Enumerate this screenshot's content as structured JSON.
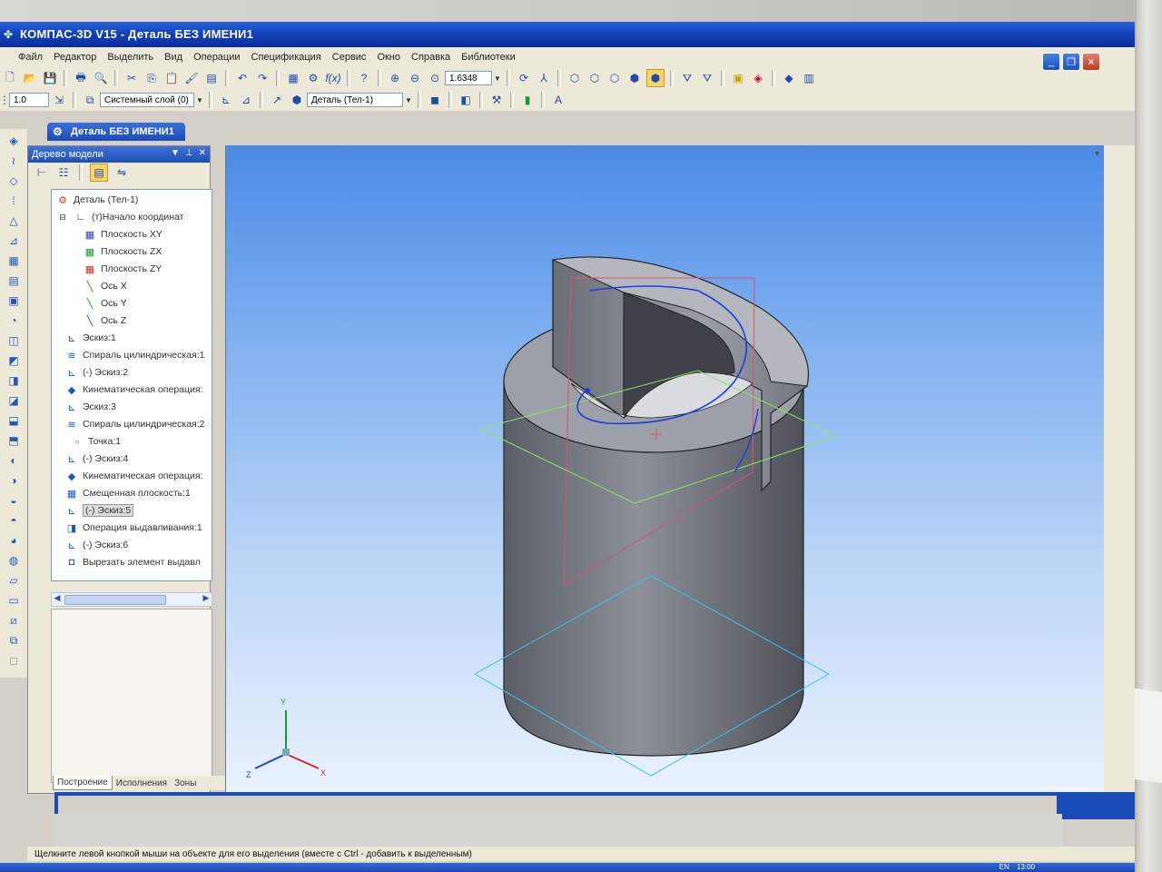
{
  "window": {
    "title": "КОМПАС-3D V15 - Деталь БЕЗ ИМЕНИ1"
  },
  "menu": [
    "Файл",
    "Редактор",
    "Выделить",
    "Вид",
    "Операции",
    "Спецификация",
    "Сервис",
    "Окно",
    "Справка",
    "Библиотеки"
  ],
  "toolbar": {
    "zoom_value": "1.6348",
    "step_value": "1.0",
    "layer_value": "Системный слой (0)",
    "detail_value": "Деталь (Тел-1)"
  },
  "doc_tab": "Деталь БЕЗ ИМЕНИ1",
  "tree": {
    "title": "Дерево модели",
    "items": [
      {
        "label": "Деталь (Тел-1)",
        "icon": "part-icon"
      },
      {
        "label": "(т)Начало координат",
        "icon": "origin-icon"
      },
      {
        "label": "Плоскость XY",
        "icon": "plane-xy-icon"
      },
      {
        "label": "Плоскость ZX",
        "icon": "plane-zx-icon"
      },
      {
        "label": "Плоскость ZY",
        "icon": "plane-zy-icon"
      },
      {
        "label": "Ось X",
        "icon": "axis-x-icon"
      },
      {
        "label": "Ось Y",
        "icon": "axis-y-icon"
      },
      {
        "label": "Ось Z",
        "icon": "axis-z-icon"
      },
      {
        "label": "Эскиз:1",
        "icon": "sketch-icon"
      },
      {
        "label": "Спираль цилиндрическая:1",
        "icon": "helix-icon"
      },
      {
        "label": "(-) Эскиз:2",
        "icon": "sketch-icon"
      },
      {
        "label": "Кинематическая операция:",
        "icon": "sweep-icon"
      },
      {
        "label": "Эскиз:3",
        "icon": "sketch-icon"
      },
      {
        "label": "Спираль цилиндрическая:2",
        "icon": "helix-icon"
      },
      {
        "label": "Точка:1",
        "icon": "point-icon"
      },
      {
        "label": "(-) Эскиз:4",
        "icon": "sketch-icon"
      },
      {
        "label": "Кинематическая операция:",
        "icon": "sweep-icon"
      },
      {
        "label": "Смещенная плоскость:1",
        "icon": "offset-plane-icon"
      },
      {
        "label": "(-) Эскиз:5",
        "icon": "sketch-icon"
      },
      {
        "label": "Операция выдавливания:1",
        "icon": "extrude-icon"
      },
      {
        "label": "(-) Эскиз:6",
        "icon": "sketch-icon"
      },
      {
        "label": "Вырезать элемент выдавл",
        "icon": "cut-extrude-icon"
      }
    ],
    "selected_index": 18
  },
  "bottom_tabs": [
    "Построение",
    "Исполнения",
    "Зоны"
  ],
  "status": "Щелкните левой кнопкой мыши на объекте для его выделения (вместе с Ctrl - добавить к выделенным)",
  "axes": {
    "x": "X",
    "y": "Y",
    "z": "Z"
  },
  "tray": {
    "lang": "EN",
    "time": "13:00"
  },
  "colors": {
    "title": "#1240b8",
    "viewport_top": "#4c8ae6",
    "viewport_bottom": "#eaf2fd",
    "selected": "#dcdcdc"
  }
}
